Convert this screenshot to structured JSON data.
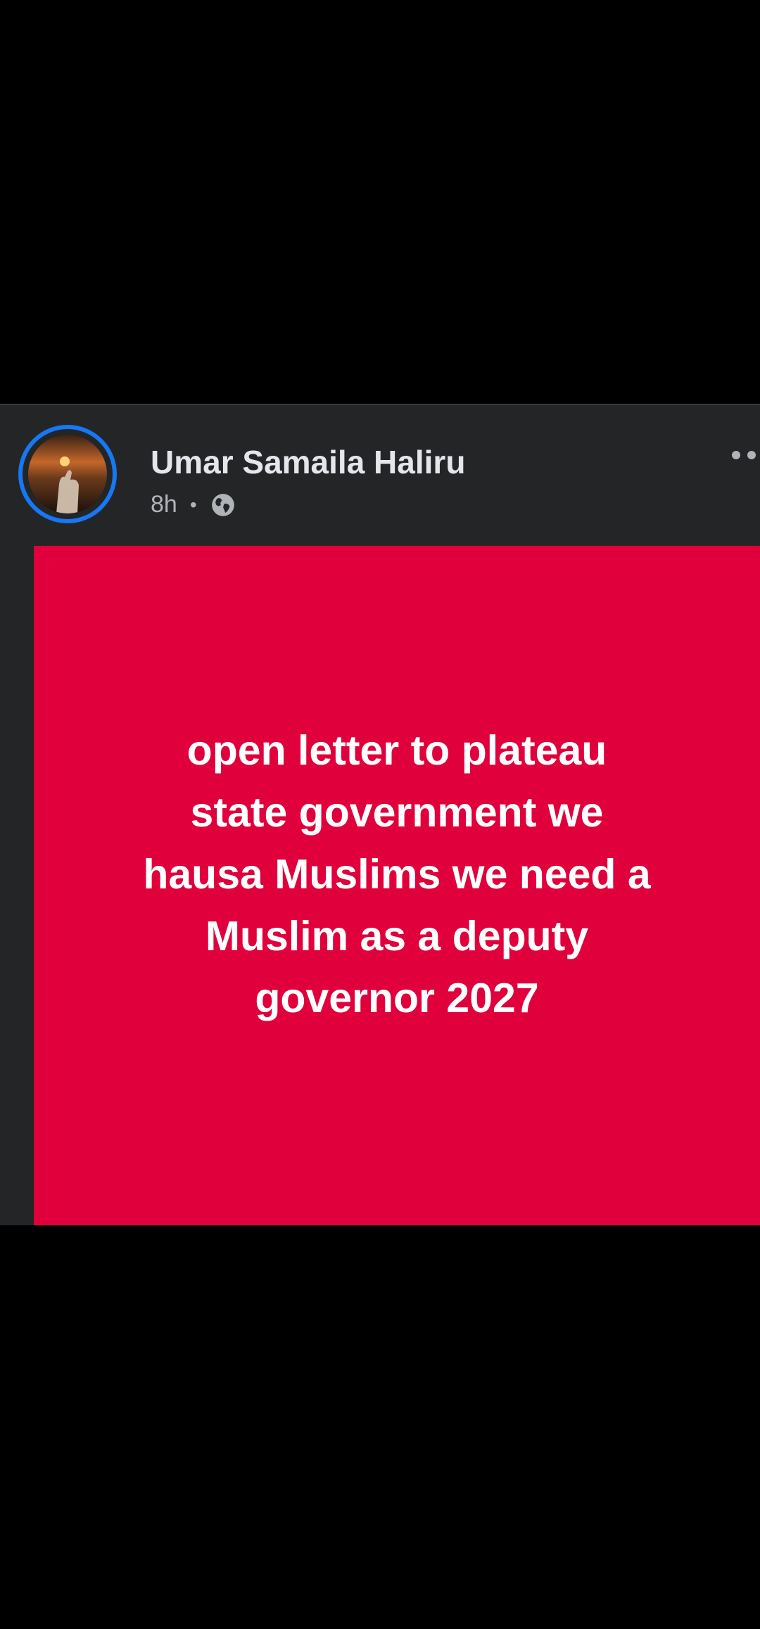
{
  "post": {
    "author": "Umar Samaila Haliru",
    "time": "8h",
    "separator": "•",
    "privacy_icon": "globe-icon",
    "more_icon": "more-options-icon",
    "image_text_lines": [
      "open letter to plateau",
      "state government we",
      "hausa Muslims we need a",
      "Muslim as a deputy",
      "governor 2027"
    ]
  },
  "colors": {
    "background": "#000000",
    "card": "#242526",
    "avatar_ring": "#1877f2",
    "post_image_bg": "#e0003b",
    "text_primary": "#e4e6eb",
    "text_secondary": "#b0b3b8"
  }
}
